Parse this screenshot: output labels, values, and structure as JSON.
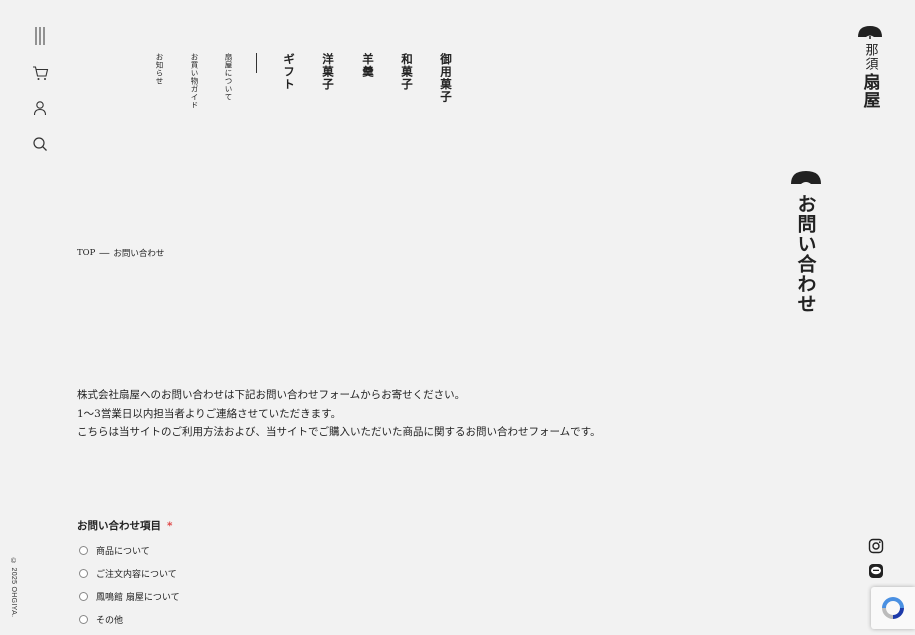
{
  "nav": {
    "items": [
      "御用菓子",
      "和菓子",
      "羊羹",
      "洋菓子",
      "ギフト"
    ],
    "sub_items": [
      "扇屋について",
      "お買い物ガイド",
      "お知らせ"
    ]
  },
  "logo": {
    "line1": "那須",
    "line2": "扇屋"
  },
  "page_heading": "お問い合わせ",
  "breadcrumb": {
    "home": "TOP",
    "separator": "―",
    "current": "お問い合わせ"
  },
  "intro": [
    "株式会社扇屋へのお問い合わせは下記お問い合わせフォームからお寄せください。",
    "1〜3営業日以内担当者よりご連絡させていただきます。",
    "こちらは当サイトのご利用方法および、当サイトでご購入いただいた商品に関するお問い合わせフォームです。"
  ],
  "form": {
    "category_label": "お問い合わせ項目",
    "required_mark": "*",
    "options": [
      "商品について",
      "ご注文内容について",
      "鳳鳴館 扇屋について",
      "その他"
    ]
  },
  "copyright": "© 2025 OHGIYA.",
  "icons": {
    "menu": "menu-icon",
    "cart": "cart-icon",
    "account": "user-icon",
    "search": "search-icon",
    "instagram": "instagram-icon",
    "line": "line-icon",
    "recaptcha": "recaptcha-icon",
    "fan": "fan-icon"
  },
  "colors": {
    "background": "#f2f2f2",
    "text": "#222222",
    "required": "#dd3333",
    "recaptcha_blue": "#4a90e2"
  }
}
